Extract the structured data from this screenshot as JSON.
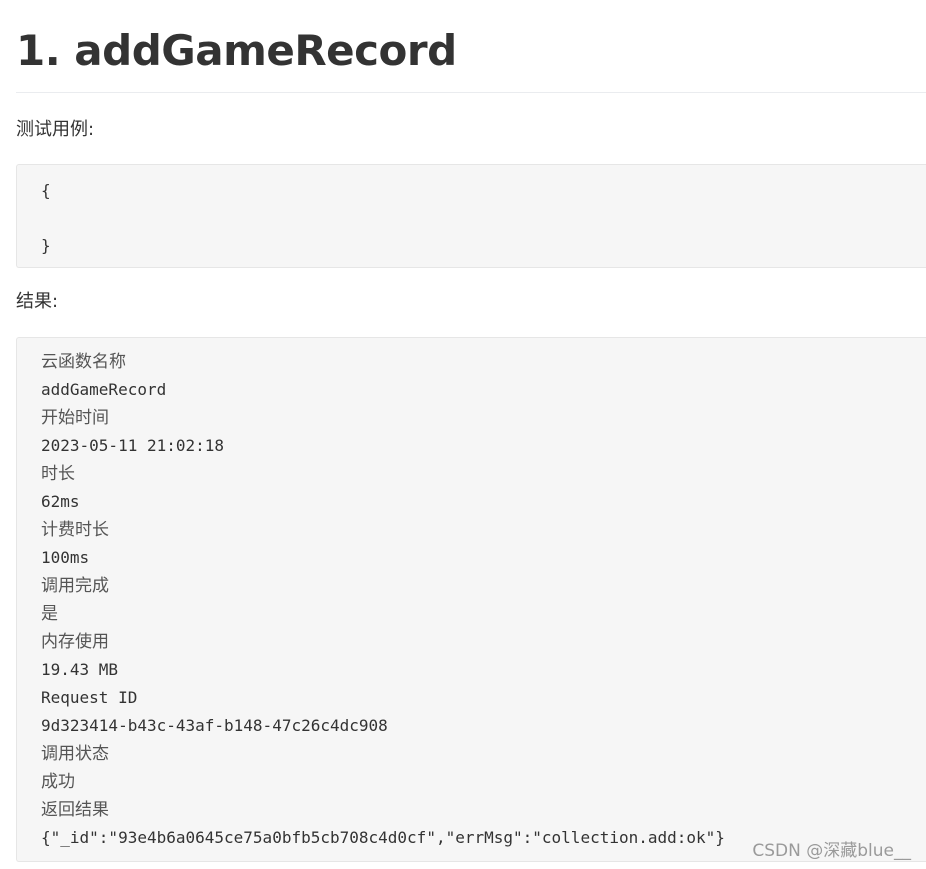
{
  "heading": "1. addGameRecord",
  "test_case_label": "测试用例:",
  "test_case_code": {
    "open_brace": "{",
    "close_brace": "}"
  },
  "result_label": "结果:",
  "result_lines": {
    "function_name_label": "云函数名称",
    "function_name_value": "addGameRecord",
    "start_time_label": "开始时间",
    "start_time_value": "2023-05-11 21:02:18",
    "duration_label": "时长",
    "duration_value": "62ms",
    "billed_duration_label": "计费时长",
    "billed_duration_value": "100ms",
    "invoke_complete_label": "调用完成",
    "invoke_complete_value": "是",
    "memory_usage_label": "内存使用",
    "memory_usage_value": "19.43 MB",
    "request_id_label": "Request ID",
    "request_id_value": "9d323414-b43c-43af-b148-47c26c4dc908",
    "invoke_status_label": "调用状态",
    "invoke_status_value": "成功",
    "return_result_label": "返回结果",
    "return_result_value": "{\"_id\":\"93e4b6a0645ce75a0bfb5cb708c4d0cf\",\"errMsg\":\"collection.add:ok\"}"
  },
  "watermark": "CSDN @深藏blue__"
}
